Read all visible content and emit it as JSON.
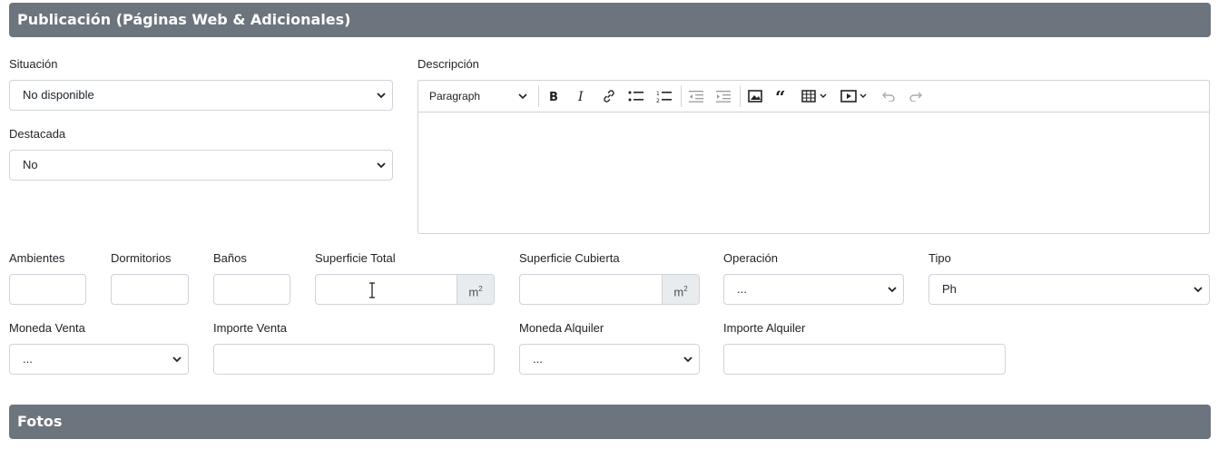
{
  "sections": {
    "publicacion_title": "Publicación (Páginas Web & Adicionales)",
    "fotos_title": "Fotos"
  },
  "fields": {
    "situacion": {
      "label": "Situación",
      "value": "No disponible"
    },
    "destacada": {
      "label": "Destacada",
      "value": "No"
    },
    "descripcion": {
      "label": "Descripción",
      "value": ""
    },
    "ambientes": {
      "label": "Ambientes",
      "value": ""
    },
    "dormitorios": {
      "label": "Dormitorios",
      "value": ""
    },
    "banos": {
      "label": "Baños",
      "value": ""
    },
    "superficie_total": {
      "label": "Superficie Total",
      "value": "",
      "unit": "m",
      "unit_sup": "2"
    },
    "superficie_cubierta": {
      "label": "Superficie Cubierta",
      "value": "",
      "unit": "m",
      "unit_sup": "2"
    },
    "operacion": {
      "label": "Operación",
      "value": "..."
    },
    "tipo": {
      "label": "Tipo",
      "value": "Ph"
    },
    "moneda_venta": {
      "label": "Moneda Venta",
      "value": "..."
    },
    "importe_venta": {
      "label": "Importe Venta",
      "value": ""
    },
    "moneda_alquiler": {
      "label": "Moneda Alquiler",
      "value": "..."
    },
    "importe_alquiler": {
      "label": "Importe Alquiler",
      "value": ""
    }
  },
  "editor": {
    "paragraph_label": "Paragraph",
    "icons": [
      "paragraph-dropdown",
      "bold-icon",
      "italic-icon",
      "link-icon",
      "bulleted-list-icon",
      "numbered-list-icon",
      "outdent-icon",
      "indent-icon",
      "image-icon",
      "blockquote-icon",
      "table-icon",
      "media-icon",
      "undo-icon",
      "redo-icon"
    ]
  },
  "colors": {
    "section_bar": "#6c757d",
    "border": "#ced4da",
    "addon_bg": "#e9ecef"
  }
}
